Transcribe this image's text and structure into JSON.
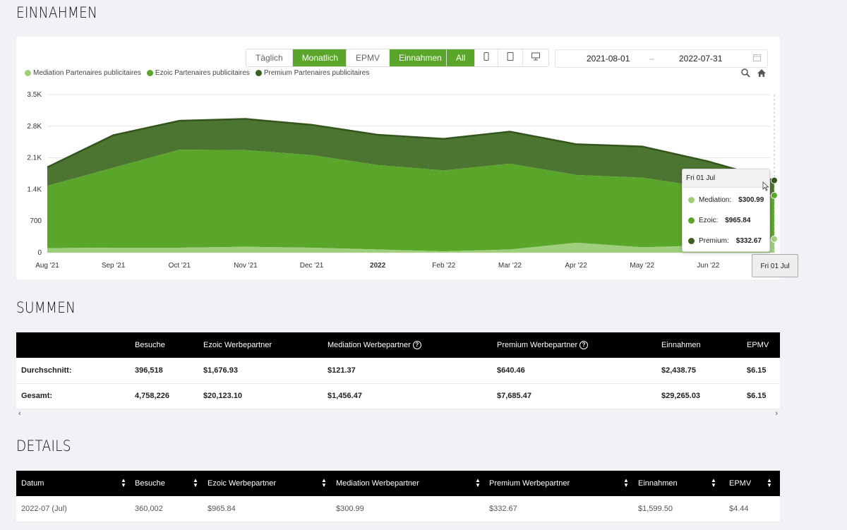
{
  "sections": {
    "einnahmen": "EINNAHMEN",
    "summen": "SUMMEN",
    "details": "DETAILS"
  },
  "toolbar": {
    "period": [
      "Täglich",
      "Monatlich"
    ],
    "active_period": "Monatlich",
    "metric": [
      "EPMV",
      "Einnahmen"
    ],
    "active_metric": "Einnahmen",
    "device_all": "All",
    "devices": [
      "phone-icon",
      "tablet-icon",
      "desktop-icon"
    ],
    "date_from": "2021-08-01",
    "date_sep": "–",
    "date_to": "2022-07-31"
  },
  "legend": [
    {
      "label": "Mediation Partenaires publicitaires",
      "color": "#9fcf7c"
    },
    {
      "label": "Ezoic Partenaires publicitaires",
      "color": "#5aa62a"
    },
    {
      "label": "Premium Partenaires publicitaires",
      "color": "#3c5f22"
    }
  ],
  "colors": {
    "mediation": "#9fcf7c",
    "ezoic": "#5aa62a",
    "premium": "#4c7531",
    "accent": "#5aa62a"
  },
  "chart_data": {
    "type": "area",
    "stacked": true,
    "categories": [
      "Aug '21",
      "Sep '21",
      "Oct '21",
      "Nov '21",
      "Dec '21",
      "2022",
      "Feb '22",
      "Mar '22",
      "Apr '22",
      "May '22",
      "Jun '22",
      "Jul '22"
    ],
    "x_tick_labels": [
      "Aug '21",
      "Sep '21",
      "Oct '21",
      "Nov '21",
      "Dec '21",
      "2022",
      "Feb '22",
      "Mar '22",
      "Apr '22",
      "May '22",
      "Jun '22"
    ],
    "y_ticks": [
      "3.5K",
      "2.8K",
      "2.1K",
      "1.4K",
      "700",
      "0"
    ],
    "ylim": [
      0,
      3500
    ],
    "series": [
      {
        "name": "Mediation Partenaires publicitaires",
        "values": [
          100,
          110,
          110,
          130,
          110,
          70,
          30,
          70,
          220,
          120,
          160,
          300.99
        ]
      },
      {
        "name": "Ezoic Partenaires publicitaires",
        "values": [
          1380,
          1770,
          2170,
          2140,
          2050,
          1870,
          1790,
          1900,
          1500,
          1540,
          1280,
          965.84
        ]
      },
      {
        "name": "Premium Partenaires publicitaires",
        "values": [
          410,
          720,
          640,
          690,
          670,
          670,
          700,
          710,
          680,
          690,
          580,
          332.67
        ]
      }
    ],
    "grid": true,
    "legend_position": "top-left"
  },
  "tooltip": {
    "title": "Fri 01 Jul",
    "rows": [
      {
        "label": "Mediation:",
        "value": "$300.99"
      },
      {
        "label": "Ezoic:",
        "value": "$965.84"
      },
      {
        "label": "Premium:",
        "value": "$332.67"
      }
    ]
  },
  "x_tip": "Fri 01 Jul",
  "summen": {
    "headers": [
      "",
      "Besuche",
      "Ezoic Werbepartner",
      "Mediation Werbepartner",
      "Premium Werbepartner",
      "Einnahmen",
      "EPMV"
    ],
    "rows": [
      [
        "Durchschnitt:",
        "396,518",
        "$1,676.93",
        "$121.37",
        "$640.46",
        "$2,438.75",
        "$6.15"
      ],
      [
        "Gesamt:",
        "4,758,226",
        "$20,123.10",
        "$1,456.47",
        "$7,685.47",
        "$29,265.03",
        "$6.15"
      ]
    ]
  },
  "details": {
    "headers": [
      "Datum",
      "Besuche",
      "Ezoic Werbepartner",
      "Mediation Werbepartner",
      "Premium Werbepartner",
      "Einnahmen",
      "EPMV"
    ],
    "rows": [
      [
        "2022-07 (Jul)",
        "360,002",
        "$965.84",
        "$300.99",
        "$332.67",
        "$1,599.50",
        "$4.44"
      ]
    ]
  }
}
